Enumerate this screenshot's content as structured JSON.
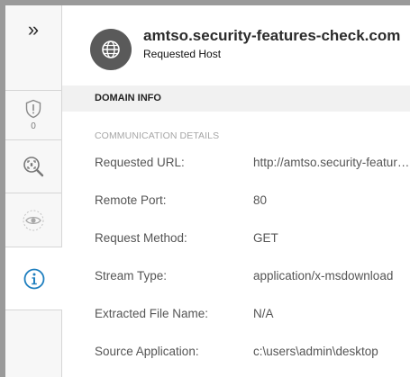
{
  "rail": {
    "expand_glyph": "»",
    "alert_count": "0",
    "icons": [
      "alert-shield-icon",
      "investigate-icon",
      "eye-icon",
      "info-icon"
    ]
  },
  "header": {
    "title": "amtso.security-features-check.com",
    "subtitle": "Requested Host",
    "icon": "globe-icon"
  },
  "section": {
    "title": "DOMAIN INFO",
    "subheading": "COMMUNICATION DETAILS"
  },
  "details": [
    {
      "label": "Requested URL:",
      "value": "http://amtso.security-features-check.com/"
    },
    {
      "label": "Remote Port:",
      "value": "80"
    },
    {
      "label": "Request Method:",
      "value": "GET"
    },
    {
      "label": "Stream Type:",
      "value": "application/x-msdownload"
    },
    {
      "label": "Extracted File Name:",
      "value": "N/A"
    },
    {
      "label": "Source Application:",
      "value": "c:\\users\\admin\\desktop"
    }
  ],
  "colors": {
    "accent": "#1f7fbf",
    "rail_bg": "#f7f7f7",
    "section_bg": "#f1f1f1"
  }
}
